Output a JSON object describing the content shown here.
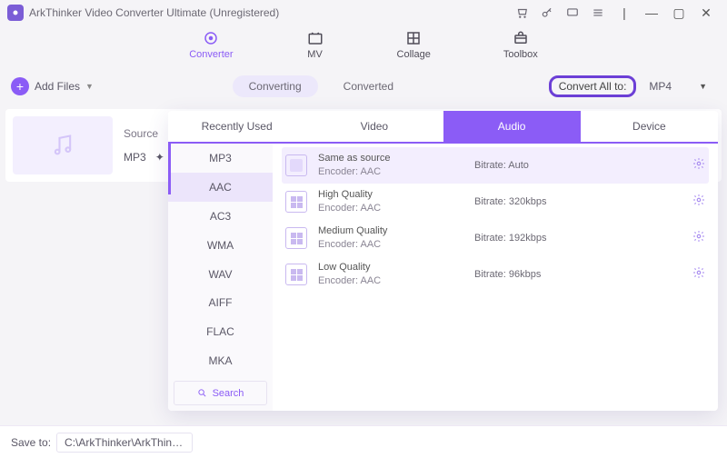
{
  "title": "ArkThinker Video Converter Ultimate (Unregistered)",
  "mainnav": {
    "converter": "Converter",
    "mv": "MV",
    "collage": "Collage",
    "toolbox": "Toolbox"
  },
  "toolbar": {
    "add_files": "Add Files",
    "converting": "Converting",
    "converted": "Converted",
    "convert_all_to": "Convert All to:",
    "selected_format": "MP4"
  },
  "file": {
    "source_label": "Source",
    "format": "MP3"
  },
  "panel": {
    "tabs": {
      "recent": "Recently Used",
      "video": "Video",
      "audio": "Audio",
      "device": "Device"
    },
    "formats": [
      "MP3",
      "AAC",
      "AC3",
      "WMA",
      "WAV",
      "AIFF",
      "FLAC",
      "MKA"
    ],
    "search": "Search",
    "presets": [
      {
        "title": "Same as source",
        "encoder": "Encoder: AAC",
        "bitrate": "Bitrate: Auto"
      },
      {
        "title": "High Quality",
        "encoder": "Encoder: AAC",
        "bitrate": "Bitrate: 320kbps"
      },
      {
        "title": "Medium Quality",
        "encoder": "Encoder: AAC",
        "bitrate": "Bitrate: 192kbps"
      },
      {
        "title": "Low Quality",
        "encoder": "Encoder: AAC",
        "bitrate": "Bitrate: 96kbps"
      }
    ]
  },
  "footer": {
    "save_to": "Save to:",
    "path": "C:\\ArkThinker\\ArkThinke...rter"
  }
}
